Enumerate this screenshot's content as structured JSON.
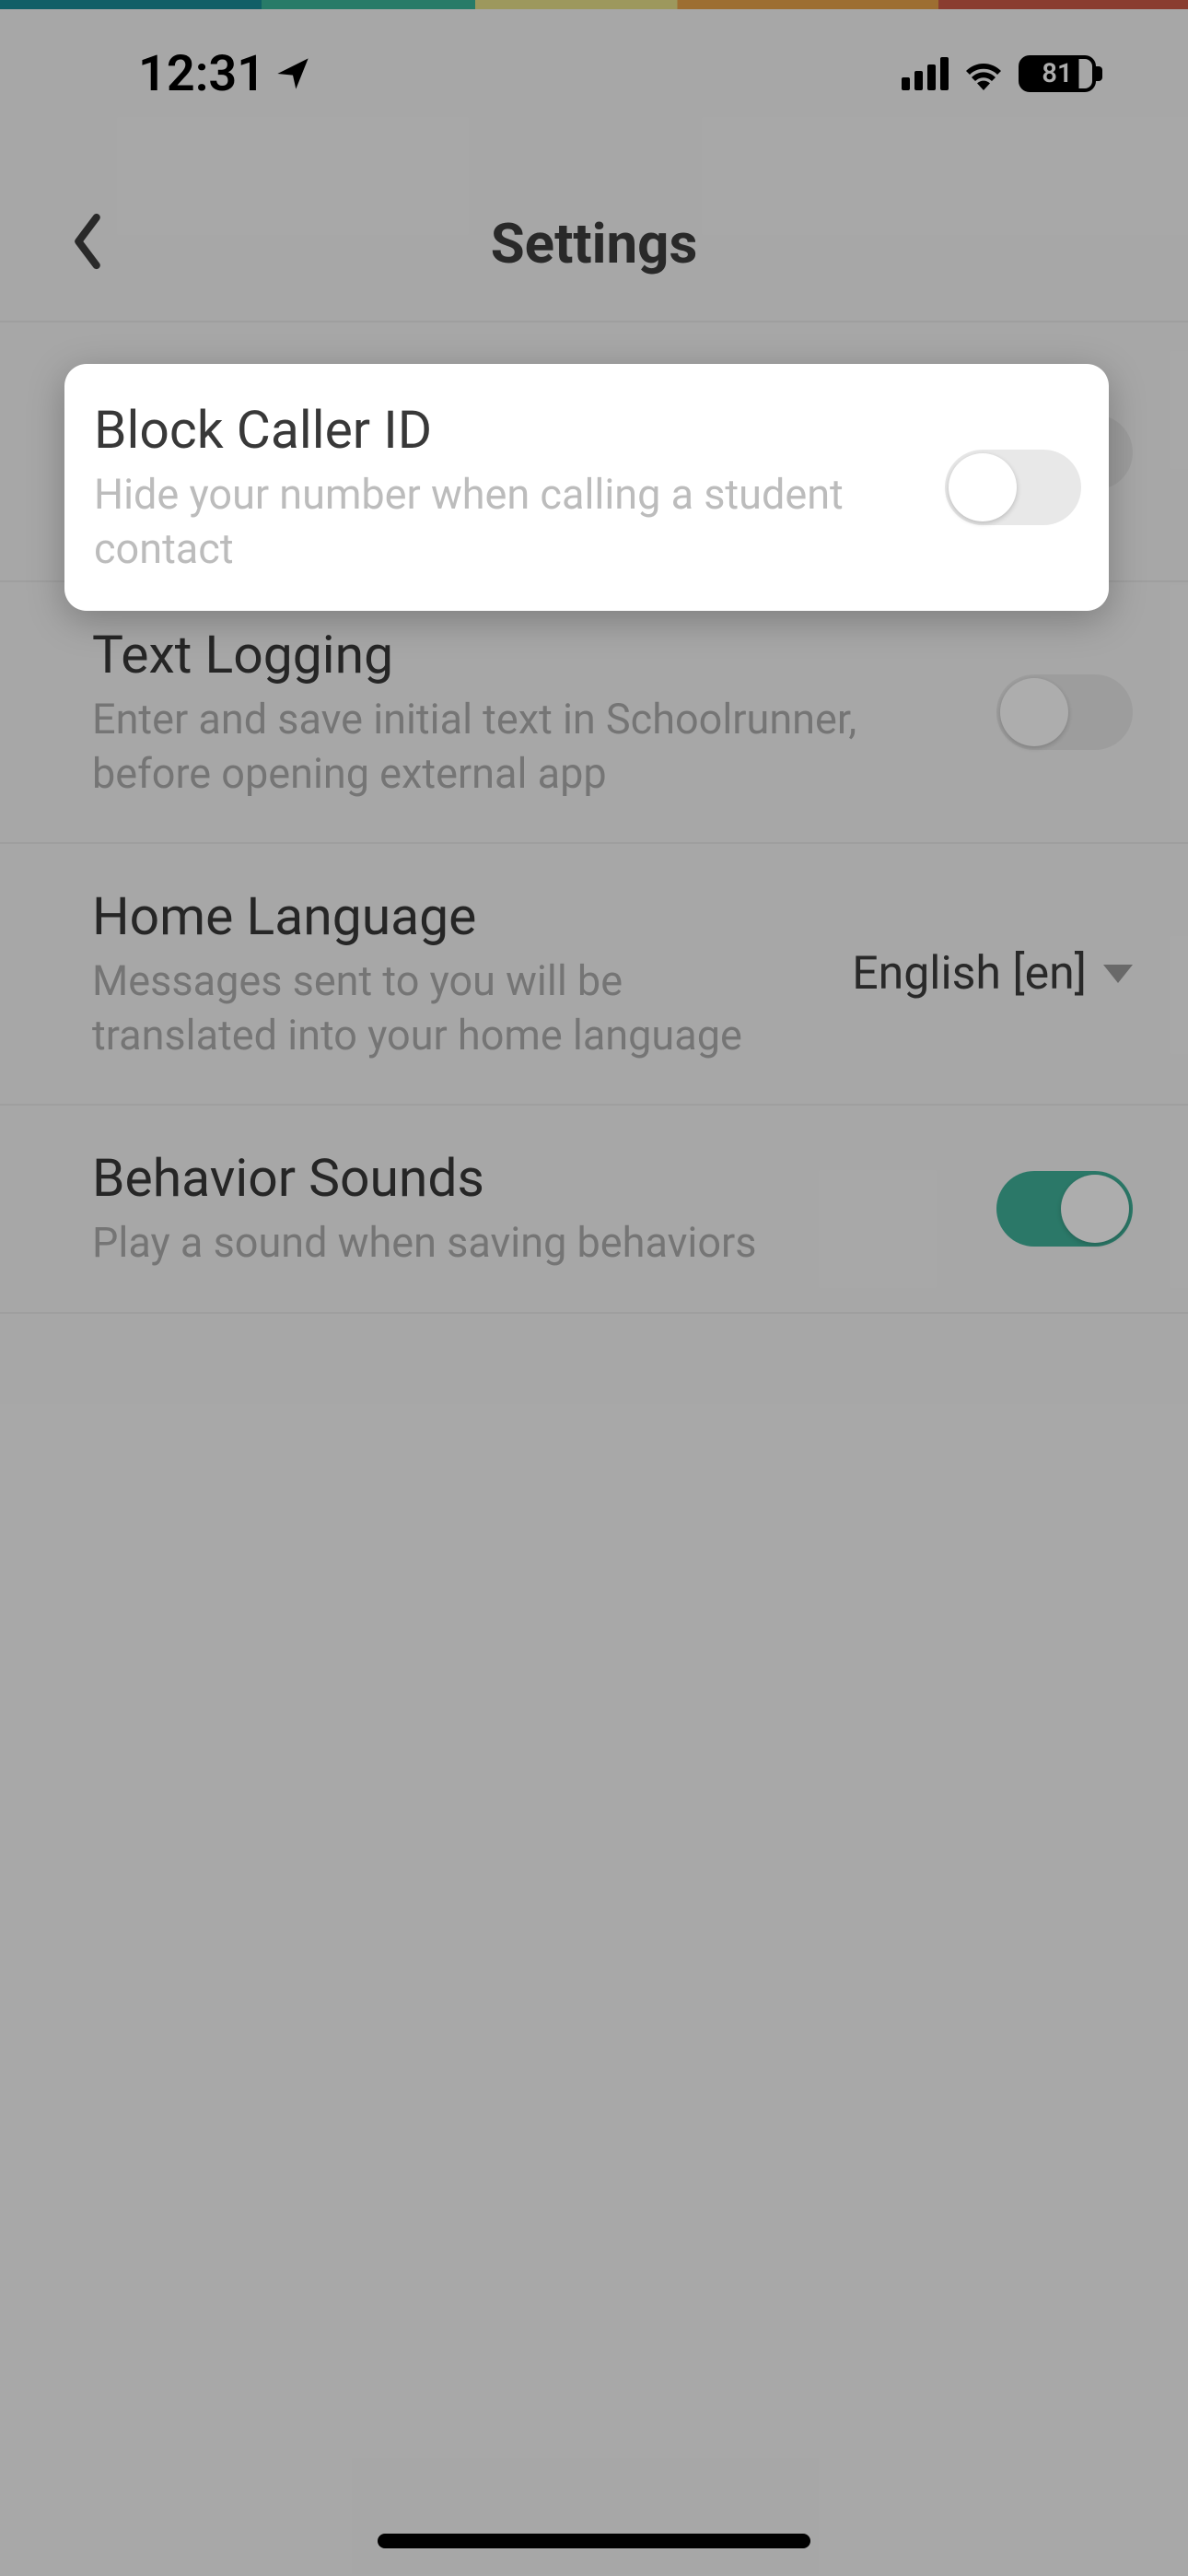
{
  "status": {
    "time": "12:31",
    "battery": "81"
  },
  "nav": {
    "title": "Settings"
  },
  "settings": {
    "block_caller_id": {
      "title": "Block Caller ID",
      "subtitle": "Hide your number when calling a student contact",
      "value": false
    },
    "text_logging": {
      "title": "Text Logging",
      "subtitle": "Enter and save initial text in Schoolrunner, before opening external app",
      "value": false
    },
    "home_language": {
      "title": "Home Language",
      "subtitle": "Messages sent to you will be translated into your home language",
      "selected": "English [en]"
    },
    "behavior_sounds": {
      "title": "Behavior Sounds",
      "subtitle": "Play a sound when saving behaviors",
      "value": true
    }
  }
}
